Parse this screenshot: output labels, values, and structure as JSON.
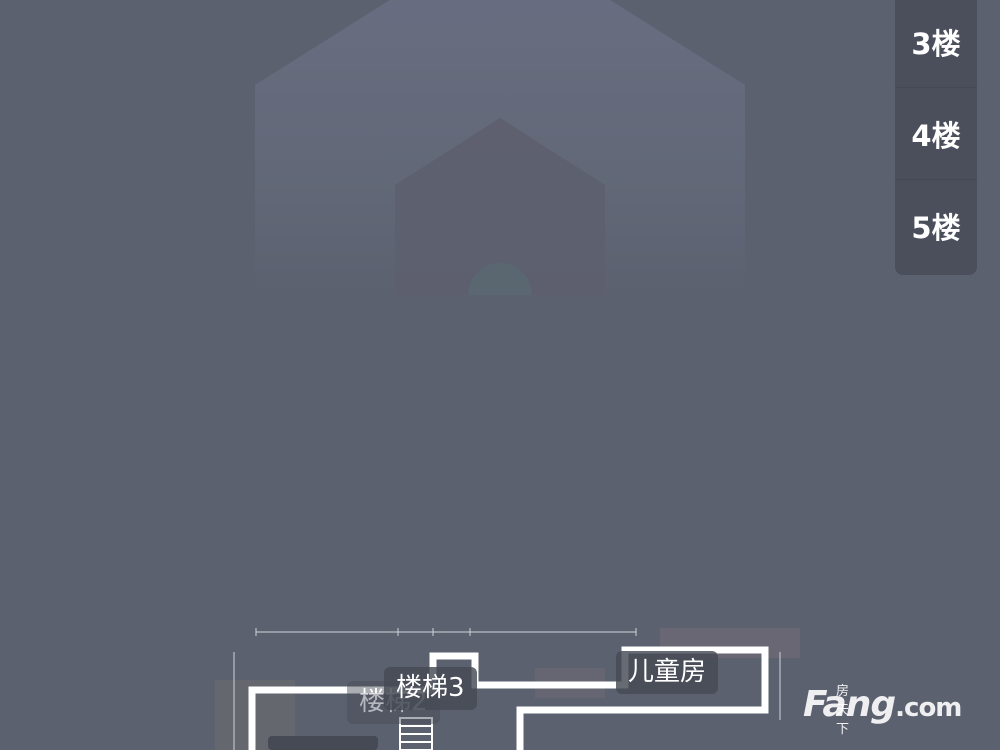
{
  "floor_menu": {
    "items": [
      {
        "label": "3楼"
      },
      {
        "label": "4楼"
      },
      {
        "label": "5楼"
      }
    ]
  },
  "floor_plan": {
    "rooms": {
      "stair2": "楼梯2",
      "stair3": "楼梯3",
      "kids_room": "儿童房"
    }
  },
  "watermark": {
    "cn": "房天下",
    "brand": "Fang",
    "domain": ".com"
  },
  "colors": {
    "background": "#5c6170",
    "menu_bg": "#4b4f5c",
    "menu_text": "#ffffff",
    "plan_wall": "#ffffff"
  },
  "icons": [
    "house-placeholder-icon"
  ]
}
